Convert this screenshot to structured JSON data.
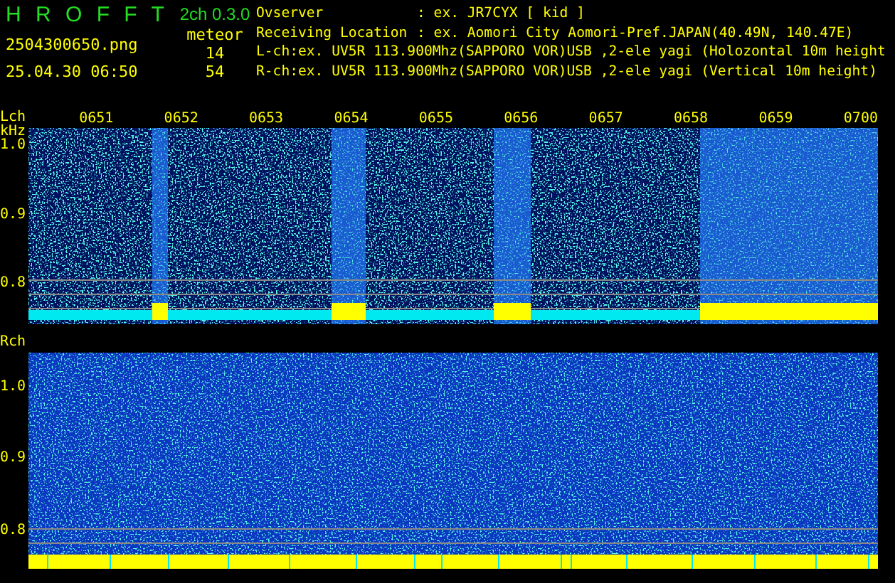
{
  "app": {
    "title": "H R O F F T",
    "version": "2ch 0.3.0",
    "mode": "meteor"
  },
  "file": {
    "name": "2504300650.png",
    "timestamp": "25.04.30 06:50"
  },
  "counts": [
    "14",
    "54"
  ],
  "info": [
    {
      "kind": "field",
      "label": "Ovserver",
      "value": ": ex. JR7CYX [ kid ]"
    },
    {
      "kind": "field",
      "label": "Receiving Location",
      "value": ": ex. Aomori City Aomori-Pref.JAPAN(40.49N, 140.47E)"
    },
    {
      "kind": "line",
      "text": "L-ch:ex. UV5R 113.900Mhz(SAPPORO VOR)USB ,2-ele yagi (Holozontal 10m height"
    },
    {
      "kind": "line",
      "text": "R-ch:ex. UV5R 113.900Mhz(SAPPORO VOR)USB ,2-ele yagi (Vertical 10m height)"
    }
  ],
  "channels": [
    {
      "label": "Lch",
      "unit": "kHz",
      "times": [
        "0651",
        "0652",
        "0653",
        "0654",
        "0655",
        "0656",
        "0657",
        "0658",
        "0659",
        "0700"
      ],
      "yticks": [
        "1.0",
        "0.9",
        "0.8"
      ]
    },
    {
      "label": "Rch",
      "yticks": [
        "1.0",
        "0.9",
        "0.8"
      ]
    }
  ]
}
